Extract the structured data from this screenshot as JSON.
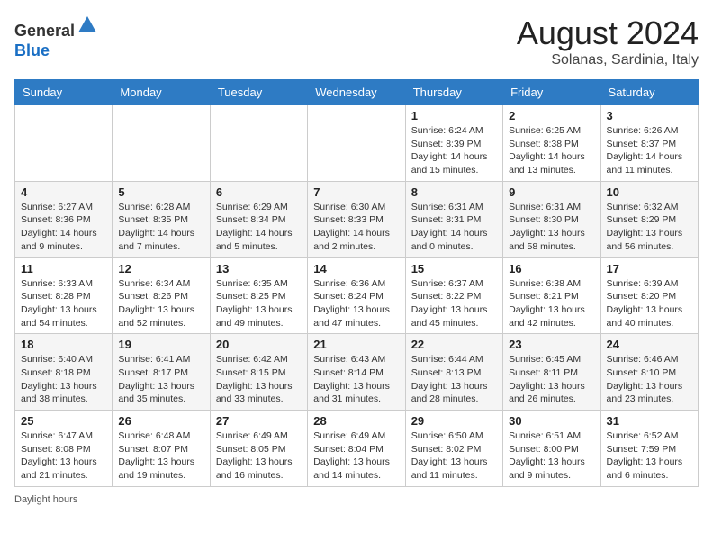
{
  "header": {
    "logo_line1": "General",
    "logo_line2": "Blue",
    "month_year": "August 2024",
    "location": "Solanas, Sardinia, Italy"
  },
  "weekdays": [
    "Sunday",
    "Monday",
    "Tuesday",
    "Wednesday",
    "Thursday",
    "Friday",
    "Saturday"
  ],
  "weeks": [
    [
      {
        "day": "",
        "info": ""
      },
      {
        "day": "",
        "info": ""
      },
      {
        "day": "",
        "info": ""
      },
      {
        "day": "",
        "info": ""
      },
      {
        "day": "1",
        "info": "Sunrise: 6:24 AM\nSunset: 8:39 PM\nDaylight: 14 hours and 15 minutes."
      },
      {
        "day": "2",
        "info": "Sunrise: 6:25 AM\nSunset: 8:38 PM\nDaylight: 14 hours and 13 minutes."
      },
      {
        "day": "3",
        "info": "Sunrise: 6:26 AM\nSunset: 8:37 PM\nDaylight: 14 hours and 11 minutes."
      }
    ],
    [
      {
        "day": "4",
        "info": "Sunrise: 6:27 AM\nSunset: 8:36 PM\nDaylight: 14 hours and 9 minutes."
      },
      {
        "day": "5",
        "info": "Sunrise: 6:28 AM\nSunset: 8:35 PM\nDaylight: 14 hours and 7 minutes."
      },
      {
        "day": "6",
        "info": "Sunrise: 6:29 AM\nSunset: 8:34 PM\nDaylight: 14 hours and 5 minutes."
      },
      {
        "day": "7",
        "info": "Sunrise: 6:30 AM\nSunset: 8:33 PM\nDaylight: 14 hours and 2 minutes."
      },
      {
        "day": "8",
        "info": "Sunrise: 6:31 AM\nSunset: 8:31 PM\nDaylight: 14 hours and 0 minutes."
      },
      {
        "day": "9",
        "info": "Sunrise: 6:31 AM\nSunset: 8:30 PM\nDaylight: 13 hours and 58 minutes."
      },
      {
        "day": "10",
        "info": "Sunrise: 6:32 AM\nSunset: 8:29 PM\nDaylight: 13 hours and 56 minutes."
      }
    ],
    [
      {
        "day": "11",
        "info": "Sunrise: 6:33 AM\nSunset: 8:28 PM\nDaylight: 13 hours and 54 minutes."
      },
      {
        "day": "12",
        "info": "Sunrise: 6:34 AM\nSunset: 8:26 PM\nDaylight: 13 hours and 52 minutes."
      },
      {
        "day": "13",
        "info": "Sunrise: 6:35 AM\nSunset: 8:25 PM\nDaylight: 13 hours and 49 minutes."
      },
      {
        "day": "14",
        "info": "Sunrise: 6:36 AM\nSunset: 8:24 PM\nDaylight: 13 hours and 47 minutes."
      },
      {
        "day": "15",
        "info": "Sunrise: 6:37 AM\nSunset: 8:22 PM\nDaylight: 13 hours and 45 minutes."
      },
      {
        "day": "16",
        "info": "Sunrise: 6:38 AM\nSunset: 8:21 PM\nDaylight: 13 hours and 42 minutes."
      },
      {
        "day": "17",
        "info": "Sunrise: 6:39 AM\nSunset: 8:20 PM\nDaylight: 13 hours and 40 minutes."
      }
    ],
    [
      {
        "day": "18",
        "info": "Sunrise: 6:40 AM\nSunset: 8:18 PM\nDaylight: 13 hours and 38 minutes."
      },
      {
        "day": "19",
        "info": "Sunrise: 6:41 AM\nSunset: 8:17 PM\nDaylight: 13 hours and 35 minutes."
      },
      {
        "day": "20",
        "info": "Sunrise: 6:42 AM\nSunset: 8:15 PM\nDaylight: 13 hours and 33 minutes."
      },
      {
        "day": "21",
        "info": "Sunrise: 6:43 AM\nSunset: 8:14 PM\nDaylight: 13 hours and 31 minutes."
      },
      {
        "day": "22",
        "info": "Sunrise: 6:44 AM\nSunset: 8:13 PM\nDaylight: 13 hours and 28 minutes."
      },
      {
        "day": "23",
        "info": "Sunrise: 6:45 AM\nSunset: 8:11 PM\nDaylight: 13 hours and 26 minutes."
      },
      {
        "day": "24",
        "info": "Sunrise: 6:46 AM\nSunset: 8:10 PM\nDaylight: 13 hours and 23 minutes."
      }
    ],
    [
      {
        "day": "25",
        "info": "Sunrise: 6:47 AM\nSunset: 8:08 PM\nDaylight: 13 hours and 21 minutes."
      },
      {
        "day": "26",
        "info": "Sunrise: 6:48 AM\nSunset: 8:07 PM\nDaylight: 13 hours and 19 minutes."
      },
      {
        "day": "27",
        "info": "Sunrise: 6:49 AM\nSunset: 8:05 PM\nDaylight: 13 hours and 16 minutes."
      },
      {
        "day": "28",
        "info": "Sunrise: 6:49 AM\nSunset: 8:04 PM\nDaylight: 13 hours and 14 minutes."
      },
      {
        "day": "29",
        "info": "Sunrise: 6:50 AM\nSunset: 8:02 PM\nDaylight: 13 hours and 11 minutes."
      },
      {
        "day": "30",
        "info": "Sunrise: 6:51 AM\nSunset: 8:00 PM\nDaylight: 13 hours and 9 minutes."
      },
      {
        "day": "31",
        "info": "Sunrise: 6:52 AM\nSunset: 7:59 PM\nDaylight: 13 hours and 6 minutes."
      }
    ]
  ],
  "footer": {
    "daylight_label": "Daylight hours"
  }
}
